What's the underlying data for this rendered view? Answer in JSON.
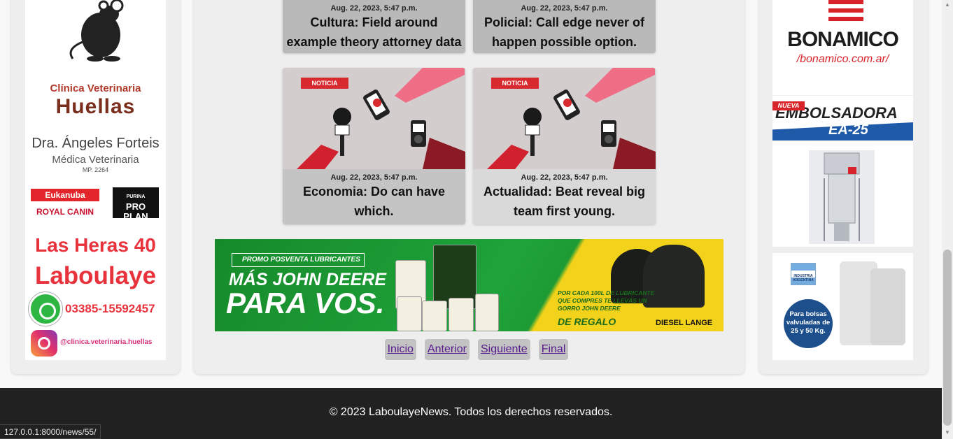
{
  "left_ad": {
    "clinic_line1": "Clínica Veterinaria",
    "clinic_line2": "Huellas",
    "doctor": "Dra. Ángeles Forteis",
    "role": "Médica Veterinaria",
    "license": "MP. 2264",
    "brand1": "Eukanuba",
    "brand2": "ROYAL CANIN",
    "brand3": "PRO PLAN",
    "brand3_top": "PURINA",
    "address": "Las Heras 40",
    "city": "Laboulaye",
    "phone": "03385-15592457",
    "instagram": "@clinica.veterinaria.huellas"
  },
  "news_cards": [
    {
      "date": "Aug. 22, 2023, 5:47 p.m.",
      "title": "Cultura: Field around example theory attorney data consider."
    },
    {
      "date": "Aug. 22, 2023, 5:47 p.m.",
      "title": "Policial: Call edge never of happen possible option."
    },
    {
      "date": "Aug. 22, 2023, 5:47 p.m.",
      "title": "Economia: Do can have which.",
      "tag": "NOTICIA"
    },
    {
      "date": "Aug. 22, 2023, 5:47 p.m.",
      "title": "Actualidad: Beat reveal big team first young.",
      "tag": "NOTICIA"
    }
  ],
  "banner": {
    "promo": "PROMO POSVENTA LUBRICANTES",
    "headline1": "MÁS JOHN DEERE",
    "headline2": "PARA VOS.",
    "offer": "POR CADA 100L DE LUBRICANTE QUE COMPRES TE LLEVÁS UN GORRO JOHN DEERE",
    "gift": "DE REGALO",
    "dealer": "DIESEL LANGE"
  },
  "pagination": {
    "first": "Inicio",
    "prev": "Anterior",
    "next": "Siguiente",
    "last": "Final"
  },
  "right_ads": {
    "bonamico_name": "BONAMICO",
    "bonamico_url": "/bonamico.com.ar/",
    "embols_badge": "NUEVA",
    "embols_title": "EMBOLSADORA",
    "embols_model": "EA-25",
    "industria": "INDUSTRIA ARGENTINA",
    "bolsas_text": "Para bolsas valvuladas de 25 y 50 Kg."
  },
  "footer": {
    "copyright": "© 2023 LaboulayeNews. Todos los derechos reservados."
  },
  "status_url": "127.0.0.1:8000/news/55/"
}
